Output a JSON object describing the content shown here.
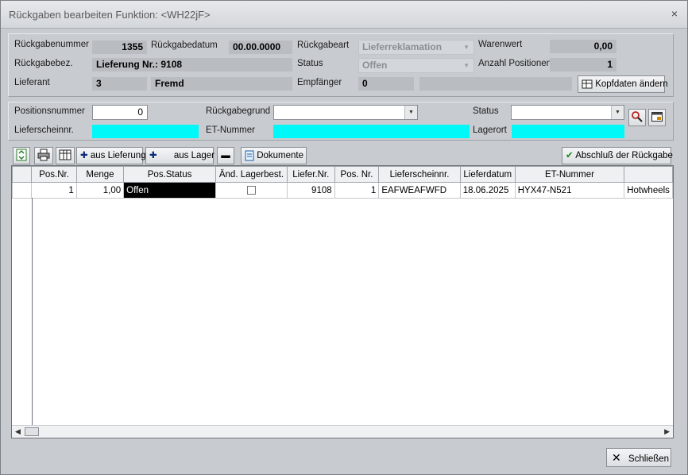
{
  "window": {
    "title": "Rückgaben bearbeiten  Funktion: <WH22jF>",
    "close_glyph": "×"
  },
  "header": {
    "rueckgabenummer_label": "Rückgabenummer",
    "rueckgabenummer": "1355",
    "rueckgabedatum_label": "Rückgabedatum",
    "rueckgabedatum": "00.00.0000",
    "rueckgabeart_label": "Rückgabeart",
    "rueckgabeart": "Lieferreklamation",
    "warenwert_label": "Warenwert",
    "warenwert": "0,00",
    "rueckgabebez_label": "Rückgabebez.",
    "rueckgabebez": "Lieferung Nr.: 9108",
    "status_label": "Status",
    "status": "Offen",
    "anzahl_label": "Anzahl Positionen",
    "anzahl": "1",
    "lieferant_label": "Lieferant",
    "lieferant_nr": "3",
    "lieferant_name": "Fremd",
    "empfaenger_label": "Empfänger",
    "empfaenger_nr": "0",
    "empfaenger_name": "",
    "kopfdaten_button": "Kopfdaten ändern"
  },
  "position": {
    "positionsnummer_label": "Positionsnummer",
    "positionsnummer": "0",
    "rueckgabegrund_label": "Rückgabegrund",
    "rueckgabegrund": "",
    "status_label": "Status",
    "status": "",
    "lieferscheinnr_label": "Lieferscheinnr.",
    "et_nummer_label": "ET-Nummer",
    "lagerort_label": "Lagerort"
  },
  "toolbar": {
    "aus_lieferung": "aus Lieferung",
    "aus_lager": "aus Lager",
    "dokumente": "Dokumente",
    "abschluss": "Abschluß der Rückgabe"
  },
  "table": {
    "columns": [
      "Pos.Nr.",
      "Menge",
      "Pos.Status",
      "Änd. Lagerbest.",
      "Liefer.Nr.",
      "Pos. Nr.",
      "Lieferscheinnr.",
      "Lieferdatum",
      "ET-Nummer",
      ""
    ],
    "rows": [
      {
        "pos_nr": "1",
        "menge": "1,00",
        "pos_status": "Offen",
        "aend_lagerbest": false,
        "liefer_nr": "9108",
        "pos_nr2": "1",
        "lieferscheinnr": "EAFWEAFWFD",
        "lieferdatum": "18.06.2025",
        "et_nummer": "HYX47-N521",
        "extra": "Hotwheels"
      }
    ]
  },
  "footer": {
    "schliessen": "Schließen"
  },
  "colors": {
    "cyan_field": "#00f8f8",
    "selected_cell": "#000000",
    "window_bg": "#c8ccd0"
  }
}
